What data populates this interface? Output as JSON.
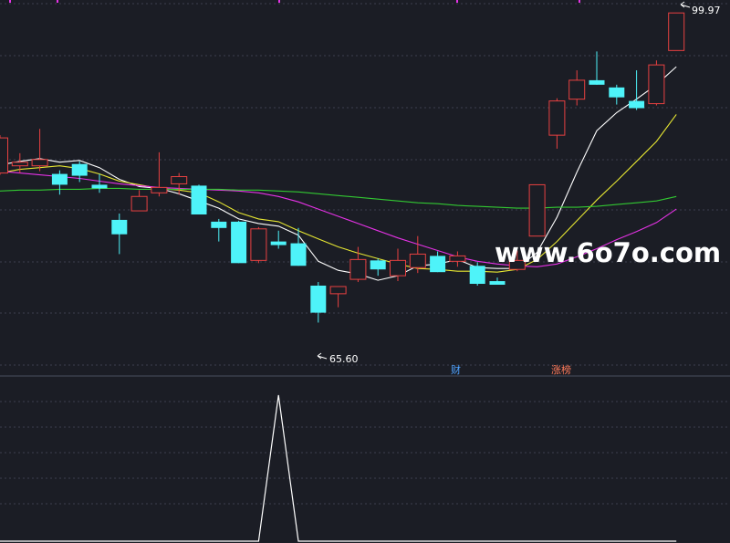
{
  "chart_data": {
    "type": "candlestick",
    "title": "",
    "price_range": [
      62,
      101
    ],
    "candles": [
      {
        "open": 82.2,
        "close": 86.1,
        "high": 86.4,
        "low": 82.0
      },
      {
        "open": 83.0,
        "close": 83.4,
        "high": 84.4,
        "low": 82.2
      },
      {
        "open": 83.0,
        "close": 83.7,
        "high": 87.1,
        "low": 82.4
      },
      {
        "open": 82.1,
        "close": 80.9,
        "high": 82.5,
        "low": 79.8
      },
      {
        "open": 83.2,
        "close": 81.9,
        "high": 83.5,
        "low": 81.2
      },
      {
        "open": 80.9,
        "close": 80.5,
        "high": 82.1,
        "low": 80.0
      },
      {
        "open": 77.0,
        "close": 75.4,
        "high": 77.7,
        "low": 73.2
      },
      {
        "open": 78.0,
        "close": 79.6,
        "high": 80.3,
        "low": 78.0
      },
      {
        "open": 80.0,
        "close": 80.6,
        "high": 84.5,
        "low": 79.6
      },
      {
        "open": 81.0,
        "close": 81.8,
        "high": 82.2,
        "low": 79.8
      },
      {
        "open": 80.8,
        "close": 77.6,
        "high": 80.9,
        "low": 77.6
      },
      {
        "open": 76.8,
        "close": 76.1,
        "high": 77.1,
        "low": 74.6
      },
      {
        "open": 76.8,
        "close": 72.2,
        "high": 76.9,
        "low": 72.2
      },
      {
        "open": 72.5,
        "close": 76.0,
        "high": 76.2,
        "low": 72.2
      },
      {
        "open": 74.6,
        "close": 74.2,
        "high": 75.8,
        "low": 73.8
      },
      {
        "open": 74.4,
        "close": 71.9,
        "high": 76.1,
        "low": 71.9
      },
      {
        "open": 69.7,
        "close": 66.7,
        "high": 70.1,
        "low": 65.6
      },
      {
        "open": 68.8,
        "close": 69.6,
        "high": 69.6,
        "low": 67.3
      },
      {
        "open": 70.4,
        "close": 72.6,
        "high": 74.0,
        "low": 70.1
      },
      {
        "open": 72.5,
        "close": 71.5,
        "high": 72.7,
        "low": 70.8
      },
      {
        "open": 70.8,
        "close": 72.5,
        "high": 73.8,
        "low": 70.2
      },
      {
        "open": 71.7,
        "close": 73.2,
        "high": 75.2,
        "low": 71.1
      },
      {
        "open": 73.0,
        "close": 71.2,
        "high": 73.5,
        "low": 71.2
      },
      {
        "open": 72.4,
        "close": 73.0,
        "high": 73.5,
        "low": 71.8
      },
      {
        "open": 71.9,
        "close": 69.9,
        "high": 72.3,
        "low": 69.7
      },
      {
        "open": 70.2,
        "close": 69.8,
        "high": 70.6,
        "low": 69.8
      },
      {
        "open": 71.5,
        "close": 72.5,
        "high": 73.6,
        "low": 71.3
      },
      {
        "open": 75.2,
        "close": 80.9,
        "high": 80.9,
        "low": 75.2
      },
      {
        "open": 86.4,
        "close": 90.2,
        "high": 90.5,
        "low": 84.9
      },
      {
        "open": 90.4,
        "close": 92.5,
        "high": 93.6,
        "low": 89.7
      },
      {
        "open": 92.5,
        "close": 92.0,
        "high": 95.7,
        "low": 92.0
      },
      {
        "open": 91.7,
        "close": 90.6,
        "high": 92.0,
        "low": 89.8
      },
      {
        "open": 90.2,
        "close": 89.4,
        "high": 93.6,
        "low": 89.2
      },
      {
        "open": 89.9,
        "close": 94.2,
        "high": 94.7,
        "low": 89.7
      },
      {
        "open": 95.8,
        "close": 99.97,
        "high": 99.97,
        "low": 95.8
      }
    ],
    "moving_averages": [
      {
        "color": "#ffffff",
        "values": [
          83.1,
          83.5,
          83.8,
          83.4,
          83.6,
          82.8,
          81.5,
          80.7,
          80.5,
          79.9,
          79.1,
          78.3,
          77.1,
          76.6,
          76.3,
          75.3,
          72.4,
          71.4,
          71.0,
          70.3,
          70.8,
          71.9,
          72.1,
          72.6,
          71.7,
          71.6,
          71.6,
          73.4,
          77.3,
          82.3,
          86.9,
          88.9,
          90.4,
          92.0,
          94.0
        ]
      },
      {
        "color": "#e6e632",
        "values": [
          82.2,
          82.6,
          82.8,
          83.0,
          82.7,
          82.1,
          81.3,
          80.9,
          80.5,
          80.3,
          80.0,
          79.0,
          77.8,
          77.1,
          76.8,
          75.8,
          74.9,
          74.0,
          73.3,
          72.7,
          72.1,
          71.6,
          71.5,
          71.3,
          71.3,
          71.2,
          71.5,
          72.6,
          74.6,
          76.9,
          79.2,
          81.3,
          83.5,
          85.7,
          88.7
        ]
      },
      {
        "color": "#e632e6",
        "values": [
          82.4,
          82.2,
          82.0,
          81.8,
          81.6,
          81.3,
          81.0,
          80.8,
          80.6,
          80.5,
          80.4,
          80.3,
          80.2,
          80.0,
          79.6,
          79.0,
          78.2,
          77.4,
          76.6,
          75.8,
          75.0,
          74.3,
          73.6,
          72.9,
          72.4,
          72.1,
          71.9,
          71.8,
          72.1,
          72.9,
          73.8,
          74.8,
          75.7,
          76.7,
          78.2
        ]
      },
      {
        "color": "#32c832",
        "values": [
          80.2,
          80.3,
          80.3,
          80.4,
          80.4,
          80.5,
          80.5,
          80.4,
          80.4,
          80.4,
          80.4,
          80.4,
          80.3,
          80.3,
          80.2,
          80.1,
          79.9,
          79.7,
          79.5,
          79.3,
          79.1,
          78.9,
          78.8,
          78.6,
          78.5,
          78.4,
          78.3,
          78.3,
          78.4,
          78.4,
          78.5,
          78.7,
          78.9,
          79.1,
          79.6
        ]
      }
    ],
    "annotations": {
      "high_label": "99.97",
      "low_label": "65.60",
      "event_cai": "财",
      "event_zhangbang": "涨榜"
    },
    "indicator": {
      "range": [
        0,
        1
      ],
      "values": [
        0,
        0,
        0,
        0,
        0,
        0,
        0,
        0,
        0,
        0,
        0,
        0,
        0,
        0,
        1,
        0,
        0,
        0,
        0,
        0,
        0,
        0,
        0,
        0,
        0,
        0,
        0,
        0,
        0,
        0,
        0,
        0,
        0,
        0,
        0
      ]
    }
  },
  "watermark": "www.6o7o.com",
  "colors": {
    "up": "#e84141",
    "down": "#4ef3f9",
    "background": "#1b1d25",
    "grid": "#3c4050",
    "indicator_line": "#ffffff"
  }
}
